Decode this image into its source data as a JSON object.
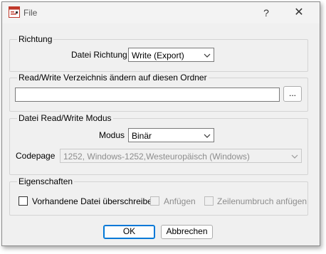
{
  "window": {
    "title": "File",
    "help_symbol": "?",
    "close_symbol": "✕"
  },
  "richtung": {
    "legend": "Richtung",
    "label": "Datei Richtung",
    "value": "Write (Export)"
  },
  "folder": {
    "legend": "Read/Write Verzeichnis ändern auf diesen Ordner",
    "path_value": "",
    "browse_label": "..."
  },
  "mode": {
    "legend": "Datei Read/Write Modus",
    "modus_label": "Modus",
    "modus_value": "Binär",
    "codepage_label": "Codepage",
    "codepage_value": "1252, Windows-1252,Westeuropäisch (Windows)"
  },
  "props": {
    "legend": "Eigenschaften",
    "overwrite_label": "Vorhandene Datei überschreiben",
    "overwrite_checked": false,
    "append_label": "Anfügen",
    "append_checked": false,
    "newline_label": "Zeilenumbruch anfügen",
    "newline_checked": false
  },
  "footer": {
    "ok_label": "OK",
    "cancel_label": "Abbrechen"
  },
  "colors": {
    "accent": "#0078d7",
    "icon_red": "#c0392b"
  }
}
